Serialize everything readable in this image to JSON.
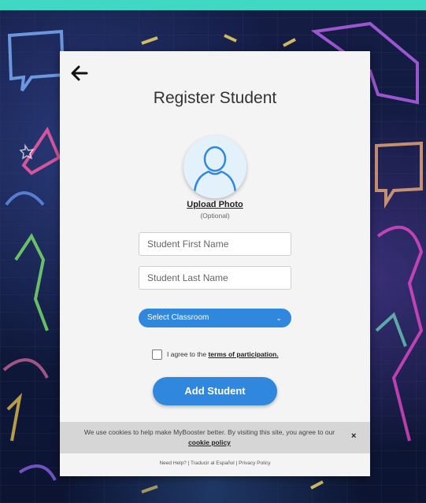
{
  "title": "Register Student",
  "avatar": {
    "icon": "user-silhouette-icon"
  },
  "upload": {
    "label": "Upload Photo",
    "optional": "(Optional)"
  },
  "first_name": {
    "placeholder": "Student First Name",
    "value": ""
  },
  "last_name": {
    "placeholder": "Student Last Name",
    "value": ""
  },
  "classroom_select": {
    "selected": "Select Classroom",
    "icon": "chevron-down-icon"
  },
  "agreement": {
    "prefix": "I agree to the ",
    "link": "terms of participation."
  },
  "submit": {
    "label": "Add Student"
  },
  "cookie_banner": {
    "text": "We use cookies to help make MyBooster better. By visiting this site, you agree to our",
    "link": "cookie policy",
    "close": "×"
  },
  "footer": {
    "help": "Need Help?",
    "sep1": " | ",
    "translate": "Traducir al Español",
    "sep2": " | ",
    "privacy": "Privacy Policy"
  },
  "colors": {
    "accent": "#2f87de",
    "top_bar": "#3ed8c3",
    "modal_bg": "#f4f4f4",
    "cookie_bg": "#d6d6d6"
  }
}
